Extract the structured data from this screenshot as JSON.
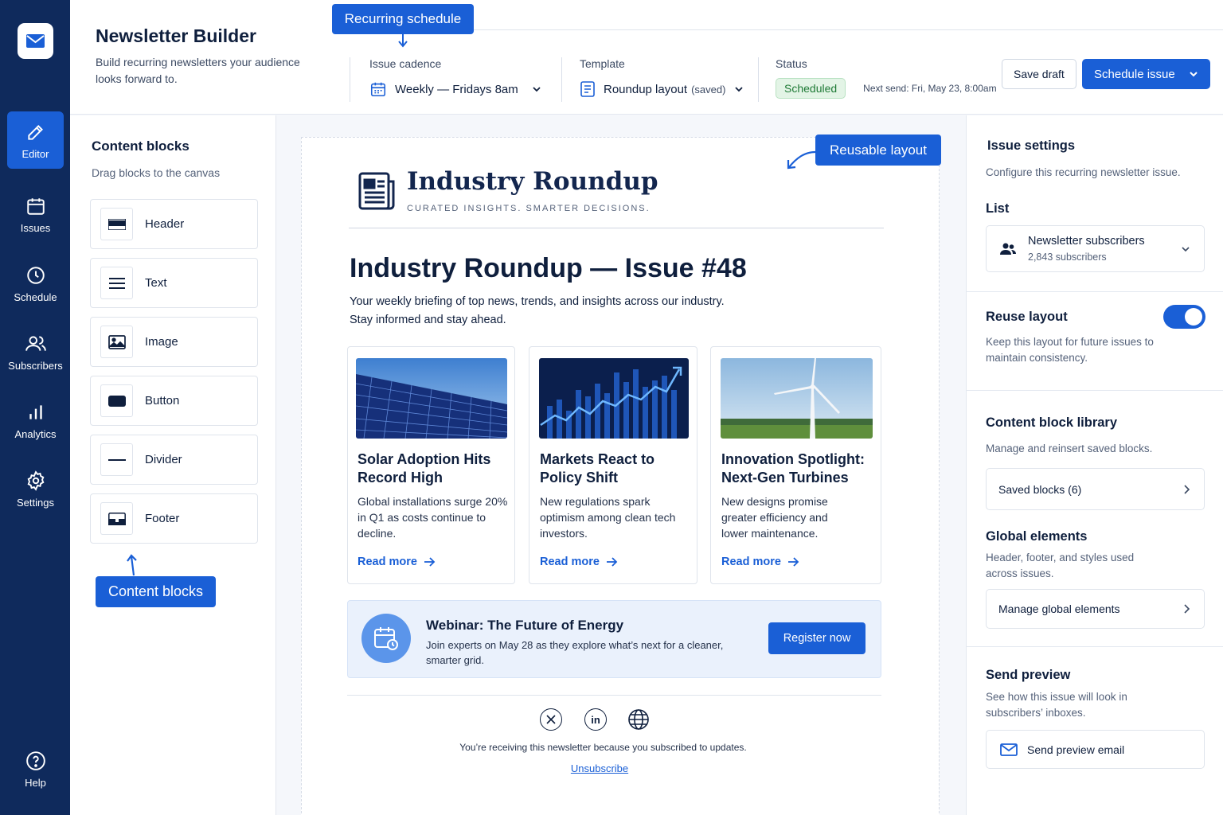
{
  "nav": {
    "items": [
      {
        "label": "Editor",
        "icon": "pencil-icon"
      },
      {
        "label": "Issues",
        "icon": "calendar-icon"
      },
      {
        "label": "Schedule",
        "icon": "clock-icon"
      },
      {
        "label": "Subscribers",
        "icon": "users-icon"
      },
      {
        "label": "Analytics",
        "icon": "bar-chart-icon"
      },
      {
        "label": "Settings",
        "icon": "gear-icon"
      }
    ],
    "help_label": "Help"
  },
  "header": {
    "title": "Newsletter Builder",
    "subtitle": "Build recurring newsletters your audience looks forward to.",
    "cadence_label": "Issue cadence",
    "cadence_value": "Weekly — Fridays 8am",
    "template_label": "Template",
    "template_value": "Roundup layout",
    "template_suffix": "(saved)",
    "status_label": "Status",
    "status_value": "Scheduled",
    "next_send": "Next send: Fri, May 23, 8:00am",
    "save_draft": "Save draft",
    "schedule_issue": "Schedule issue"
  },
  "callouts": {
    "recurring": "Recurring schedule",
    "reusable": "Reusable layout",
    "content_blocks": "Content blocks"
  },
  "content_blocks": {
    "title": "Content blocks",
    "subtitle": "Drag blocks to the canvas",
    "items": [
      "Header",
      "Text",
      "Image",
      "Button",
      "Divider",
      "Footer"
    ]
  },
  "newsletter": {
    "brand": "Industry Roundup",
    "tagline": "CURATED INSIGHTS. SMARTER DECISIONS.",
    "issue_title": "Industry Roundup — Issue #48",
    "intro_line1": "Your weekly briefing of top news, trends, and insights across our industry.",
    "intro_line2": "Stay informed and stay ahead.",
    "articles": [
      {
        "title": "Solar Adoption Hits Record High",
        "body": "Global installations surge 20% in Q1 as costs continue to decline.",
        "link": "Read more"
      },
      {
        "title": "Markets React to Policy Shift",
        "body": "New regulations spark optimism among clean tech investors.",
        "link": "Read more"
      },
      {
        "title": "Innovation Spotlight: Next-Gen Turbines",
        "body": "New designs promise greater efficiency and lower maintenance.",
        "link": "Read more"
      }
    ],
    "webinar": {
      "title": "Webinar: The Future of Energy",
      "body": "Join experts on May 28 as they explore what’s next for a cleaner, smarter grid.",
      "button": "Register now"
    },
    "social": [
      "x-icon",
      "linkedin-icon",
      "globe-icon"
    ],
    "linkedin_text": "in",
    "footer_note": "You’re receiving this newsletter because you subscribed to updates.",
    "unsubscribe": "Unsubscribe"
  },
  "settings": {
    "title": "Issue settings",
    "subtitle": "Configure this recurring newsletter issue.",
    "list_label": "List",
    "list_name": "Newsletter subscribers",
    "list_count": "2,843 subscribers",
    "reuse_title": "Reuse layout",
    "reuse_desc": "Keep this layout for future issues to maintain consistency.",
    "reuse_on": true,
    "library_title": "Content block library",
    "library_sub": "Manage and reinsert saved blocks.",
    "saved_blocks": "Saved blocks (6)",
    "global_title": "Global elements",
    "global_sub": "Header, footer, and styles used across issues.",
    "manage_global": "Manage global elements",
    "preview_title": "Send preview",
    "preview_sub": "See how this issue will look in subscribers’ inboxes.",
    "preview_button": "Send preview email"
  },
  "colors": {
    "rail": "#0f2a5c",
    "accent": "#1a5fd6",
    "status_green": "#1f7a36"
  }
}
